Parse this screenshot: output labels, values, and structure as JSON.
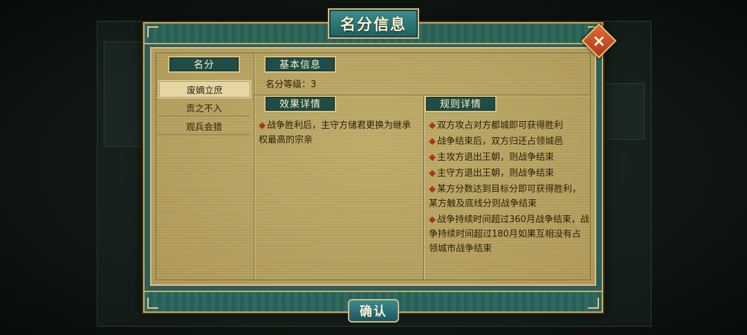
{
  "dialog": {
    "title": "名分信息",
    "confirm_label": "确认",
    "close_glyph": "×"
  },
  "left_panel": {
    "header": "名分",
    "items": [
      {
        "label": "废嫡立庶",
        "selected": true
      },
      {
        "label": "贡之不入",
        "selected": false
      },
      {
        "label": "观兵会猎",
        "selected": false
      }
    ]
  },
  "basic_info": {
    "header": "基本信息",
    "level_label": "名分等级：",
    "level_value": "3"
  },
  "effects": {
    "header": "效果详情",
    "items": [
      "战争胜利后，主守方储君更换为继承权最高的宗亲"
    ]
  },
  "rules": {
    "header": "规则详情",
    "items": [
      "双方攻占对方都城即可获得胜利",
      "战争结束后，双方归还占领城邑",
      "主攻方退出王朝，则战争结束",
      "主守方退出王朝，则战争结束",
      "某方分数达到目标分即可获得胜利，某方触及底线分则战争结束",
      "战争持续时间超过360月战争结束，战争持续时间超过180月如果互相没有占领城市战争结束"
    ]
  },
  "colors": {
    "panel": "#b7a361",
    "frame": "#2d5f58",
    "gold_border": "#c9ad6a",
    "bullet": "#a23a1c",
    "close": "#c8472a"
  }
}
